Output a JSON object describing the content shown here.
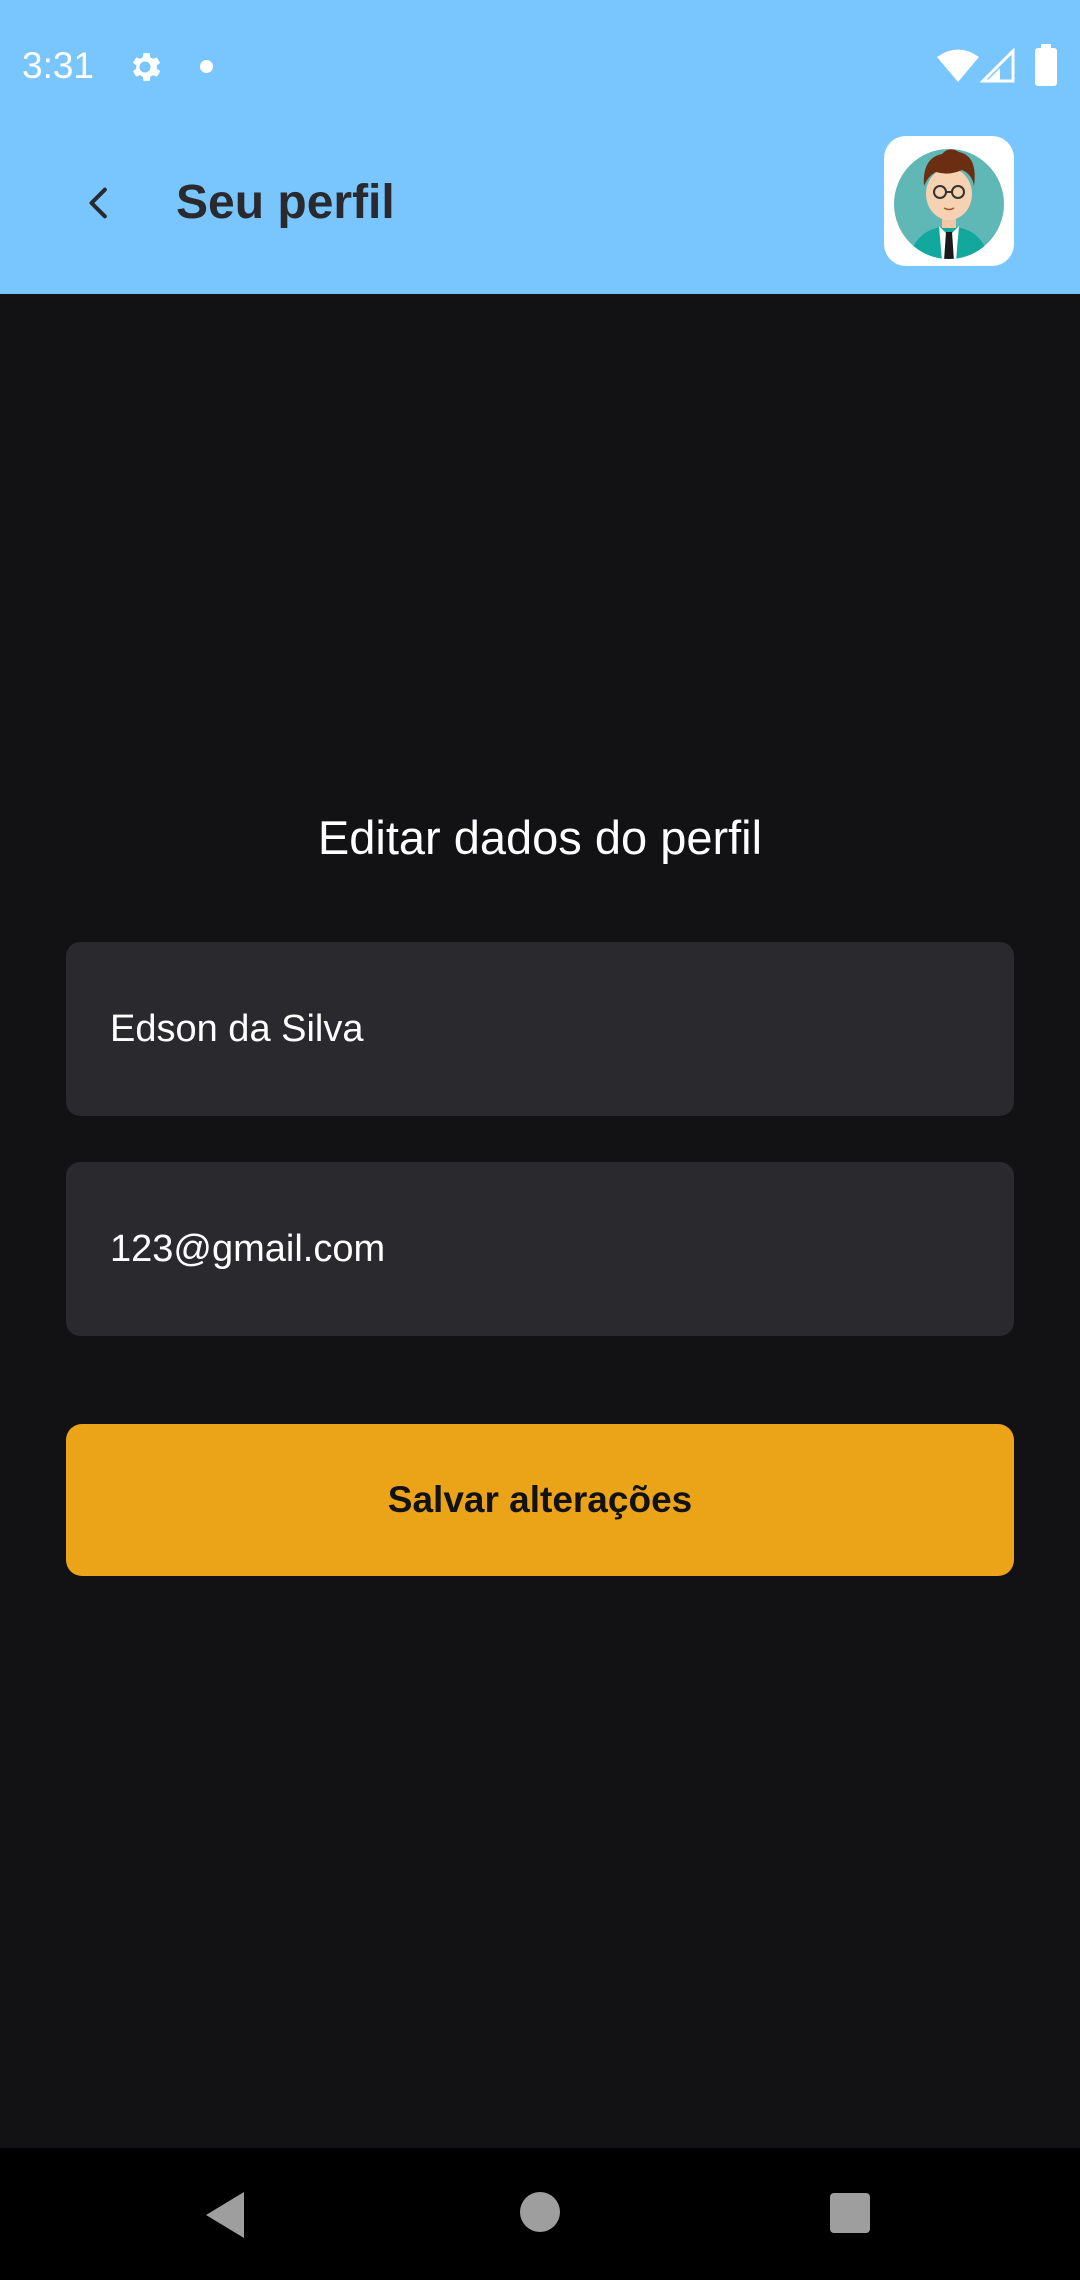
{
  "status_bar": {
    "time": "3:31",
    "icons": [
      "gear-icon",
      "notification-dot",
      "wifi-icon",
      "signal-icon",
      "battery-icon"
    ]
  },
  "app_bar": {
    "title": "Seu perfil",
    "back_icon": "chevron-left-icon",
    "avatar": "user-avatar"
  },
  "form": {
    "title": "Editar dados do perfil",
    "name_value": "Edson da Silva",
    "email_value": "123@gmail.com",
    "save_label": "Salvar alterações"
  },
  "nav_bar": {
    "icons": [
      "nav-back-icon",
      "nav-home-icon",
      "nav-recents-icon"
    ]
  },
  "colors": {
    "header": "#79C5FE",
    "background": "#121214",
    "field": "#29292E",
    "button": "#EBA417",
    "title_text": "#29292E"
  }
}
